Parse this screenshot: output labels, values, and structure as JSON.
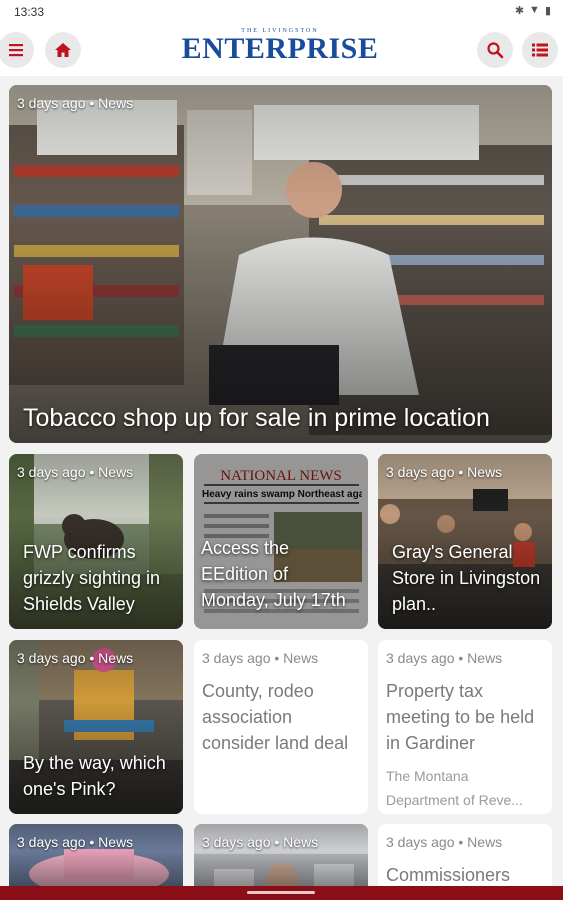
{
  "status": {
    "time": "13:33",
    "icons": [
      "bluetooth-icon",
      "wifi-icon",
      "battery-icon"
    ]
  },
  "header": {
    "logo_sub": "THE LIVINGSTON",
    "logo_main": "ENTERPRISE",
    "accent_color": "#c0131f",
    "logo_color": "#1a4c9c"
  },
  "featured": {
    "meta": "3 days ago • News",
    "title": "Tobacco shop up for sale in prime location"
  },
  "cards": [
    {
      "meta": "3 days ago • News",
      "title": "FWP confirms grizzly sighting in Shields Valley"
    },
    {
      "meta": "",
      "title": "Access the EEdition of Monday, July 17th",
      "paper_masthead": "NATIONAL NEWS",
      "paper_headline": "Heavy rains swamp Northeast again"
    },
    {
      "meta": "3 days ago • News",
      "title": "Gray's General Store in Livingston plan.."
    },
    {
      "meta": "3 days ago • News",
      "title": "By the way, which one's Pink?"
    },
    {
      "meta": "3 days ago • News",
      "title": "County, rodeo association consider land deal"
    },
    {
      "meta": "3 days ago • News",
      "title": "Property tax meeting to be held in Gardiner",
      "description": "The Montana Department of Reve..."
    },
    {
      "meta": "3 days ago • News",
      "title": ""
    },
    {
      "meta": "3 days ago • News",
      "title": ""
    },
    {
      "meta": "3 days ago • News",
      "title": "Commissioners"
    }
  ],
  "colors": {
    "bottom_bar": "#8b0d16",
    "button_bg": "#e9e9e9"
  }
}
